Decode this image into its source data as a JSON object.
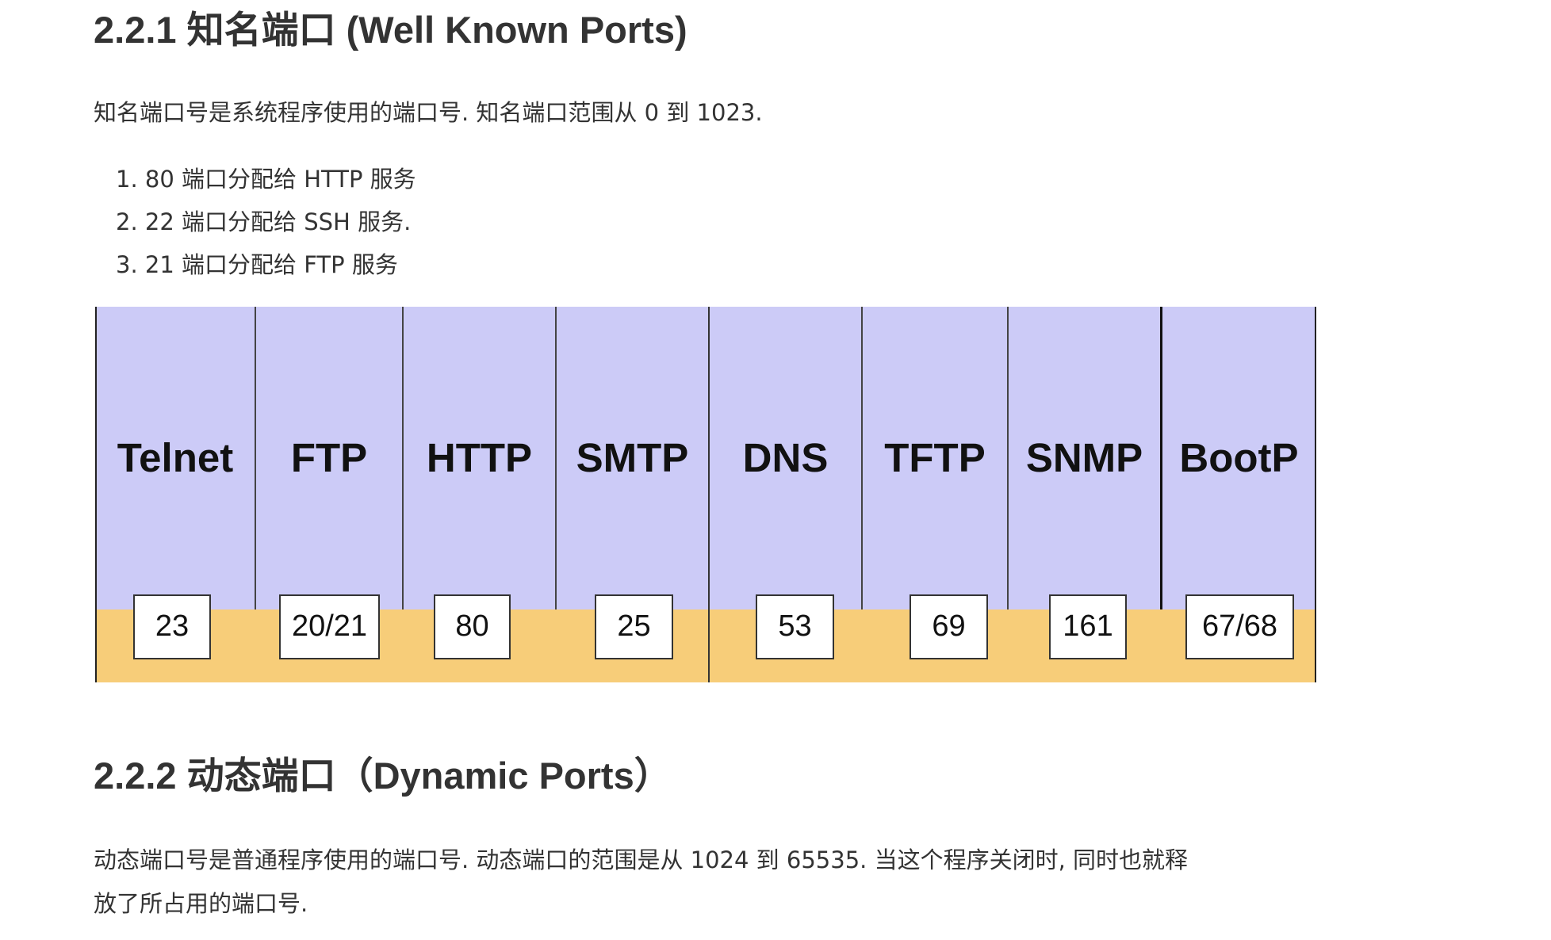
{
  "section_well_known": {
    "heading": "2.2.1 知名端口 (Well Known Ports)",
    "description": "知名端口号是系统程序使用的端口号. 知名端口范围从 0 到 1023.",
    "list": [
      "1. 80 端口分配给 HTTP 服务",
      "2. 22 端口分配给 SSH 服务.",
      "3. 21 端口分配给 FTP 服务"
    ]
  },
  "diagram": {
    "colors": {
      "top_band": "#cccbf7",
      "bottom_band": "#f7cd79",
      "box": "#ffffff",
      "line": "#222222"
    },
    "protocols": [
      {
        "name": "Telnet",
        "port": "23"
      },
      {
        "name": "FTP",
        "port": "20/21"
      },
      {
        "name": "HTTP",
        "port": "80"
      },
      {
        "name": "SMTP",
        "port": "25"
      },
      {
        "name": "DNS",
        "port": "53"
      },
      {
        "name": "TFTP",
        "port": "69"
      },
      {
        "name": "SNMP",
        "port": "161"
      },
      {
        "name": "BootP",
        "port": "67/68"
      }
    ]
  },
  "section_dynamic": {
    "heading": "2.2.2 动态端口（Dynamic Ports）",
    "description_line1": "动态端口号是普通程序使用的端口号. 动态端口的范围是从 1024 到 65535. 当这个程序关闭时, 同时也就释",
    "description_line2": "放了所占用的端口号."
  }
}
